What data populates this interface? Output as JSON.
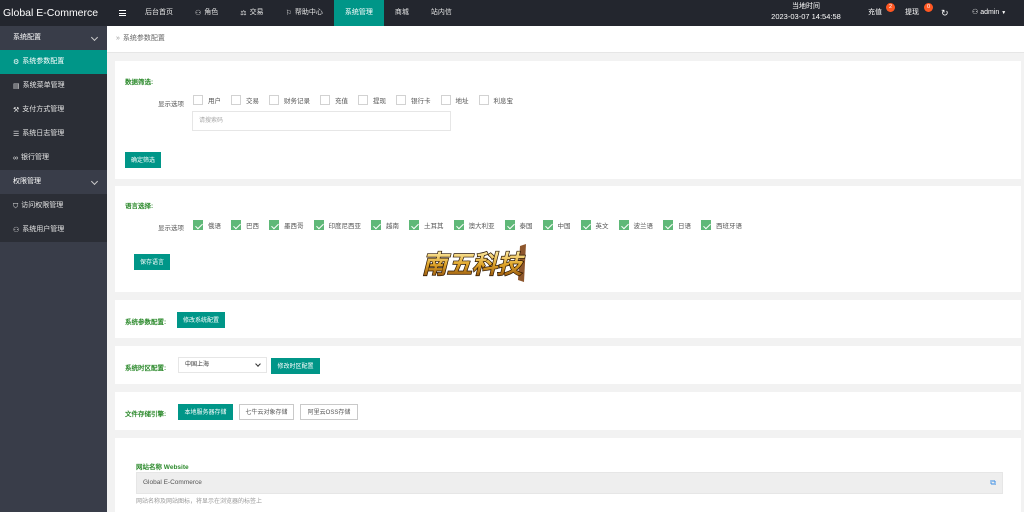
{
  "brand": "Global E-Commerce",
  "nav": [
    {
      "label": "后台首页",
      "icon": ""
    },
    {
      "label": "角色",
      "icon": "user-icon"
    },
    {
      "label": "交易",
      "icon": "scale-icon"
    },
    {
      "label": "帮助中心",
      "icon": "flag-icon"
    },
    {
      "label": "系统管理",
      "icon": "",
      "active": true
    },
    {
      "label": "商城",
      "icon": ""
    },
    {
      "label": "站内信",
      "icon": ""
    }
  ],
  "clock": {
    "label": "当地时间",
    "time": "2023-03-07 14:54:58"
  },
  "topright": {
    "recharge": "充值",
    "recharge_badge": "2",
    "withdraw": "提现",
    "withdraw_badge": "0",
    "user": "admin"
  },
  "sidebar": {
    "group1": "系统配置",
    "items1": [
      "系统参数配置",
      "系统菜单管理",
      "支付方式管理",
      "系统日志管理",
      "银行管理"
    ],
    "group2": "权限管理",
    "items2": [
      "访问权限管理",
      "系统用户管理"
    ]
  },
  "breadcrumb": "系统参数配置",
  "data_filter": {
    "title": "数据筛选:",
    "row_label": "显示选项",
    "options": [
      "用户",
      "交易",
      "财务记录",
      "充值",
      "提现",
      "银行卡",
      "地址",
      "利息宝"
    ],
    "placeholder": "请搜索码",
    "button": "确定筛选"
  },
  "language": {
    "title": "语言选择:",
    "row_label": "显示选项",
    "options": [
      "俄语",
      "巴西",
      "墨西哥",
      "印度尼西亚",
      "越南",
      "土耳其",
      "澳大利亚",
      "泰国",
      "中国",
      "英文",
      "波兰语",
      "日语",
      "西班牙语"
    ],
    "button": "保存语言",
    "logo_text": "南五科技"
  },
  "sys_params": {
    "title": "系统参数配置:",
    "button": "修改系统配置"
  },
  "timezone": {
    "title": "系统时区配置:",
    "selected": "中国上海",
    "button": "修改时区配置"
  },
  "storage": {
    "title": "文件存储引擎:",
    "buttons": [
      "本地服务器存储",
      "七牛云对象存储",
      "阿里云OSS存储"
    ]
  },
  "website": {
    "title": "网站名称 Website",
    "value": "Global E-Commerce",
    "hint": "网站名称及网站图标，将显示在浏览器的标签上"
  },
  "colors": {
    "accent": "#009688",
    "topbar": "#23262e",
    "sidebar": "#393d49",
    "check": "#5fb878",
    "label": "#2e8b2e"
  }
}
